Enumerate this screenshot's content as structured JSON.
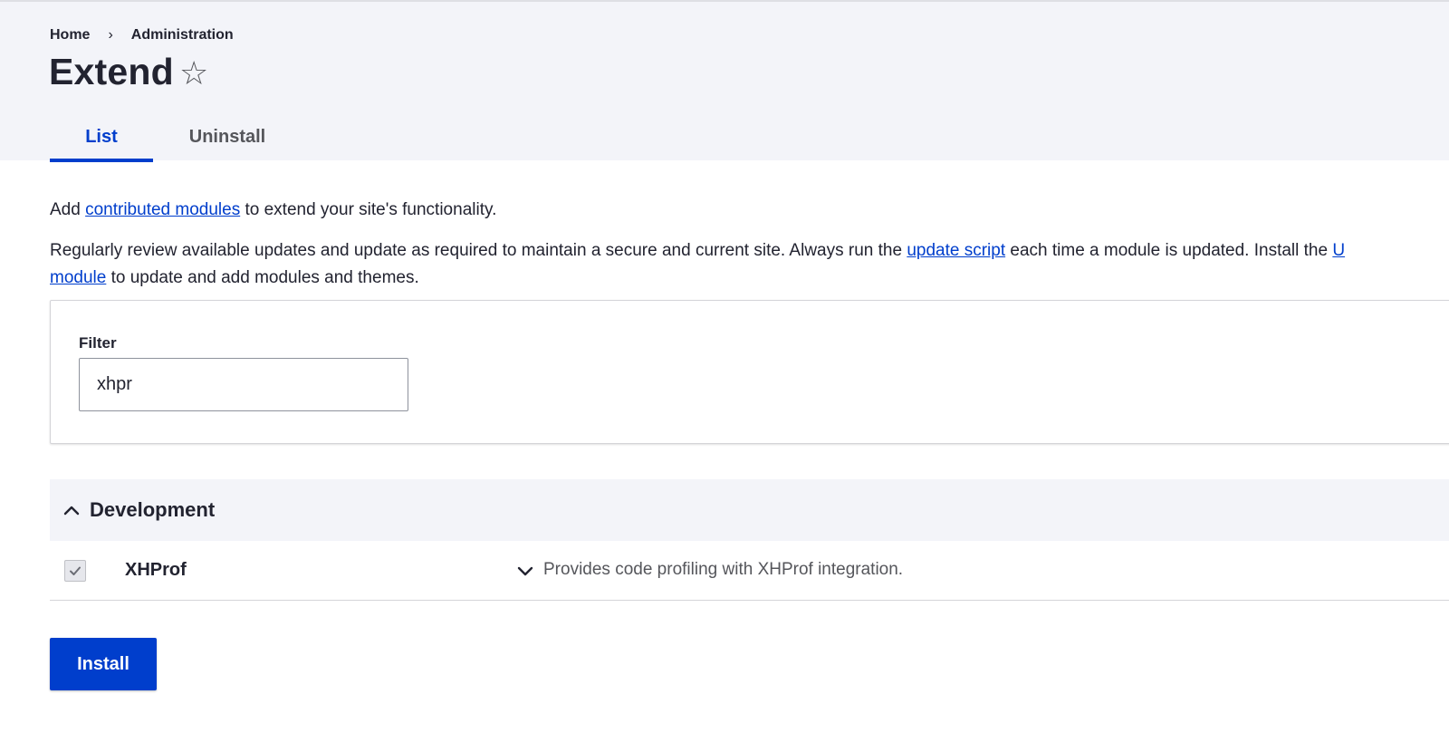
{
  "breadcrumb": {
    "items": [
      "Home",
      "Administration"
    ],
    "separator": "›"
  },
  "page": {
    "title": "Extend",
    "favorite_icon": "star-outline-icon"
  },
  "tabs": [
    {
      "label": "List",
      "active": true
    },
    {
      "label": "Uninstall",
      "active": false
    }
  ],
  "intro": {
    "prefix": "Add ",
    "link": "contributed modules",
    "suffix": " to extend your site's functionality."
  },
  "review": {
    "text1": "Regularly review available updates and update as required to maintain a secure and current site. Always run the ",
    "link1": "update script",
    "text2": " each time a module is updated. Install the ",
    "link2a": "U",
    "link2b": "module",
    "text3": " to update and add modules and themes."
  },
  "filter": {
    "label": "Filter",
    "value": "xhpr"
  },
  "group": {
    "title": "Development",
    "icon": "chevron-up-icon",
    "modules": [
      {
        "name": "XHProf",
        "checked": true,
        "description": "Provides code profiling with XHProf integration.",
        "expand_icon": "chevron-down-icon"
      }
    ]
  },
  "actions": {
    "install_label": "Install"
  },
  "colors": {
    "accent": "#003ecc",
    "header_bg": "#f3f4f9",
    "text": "#222330",
    "muted": "#55565b"
  }
}
